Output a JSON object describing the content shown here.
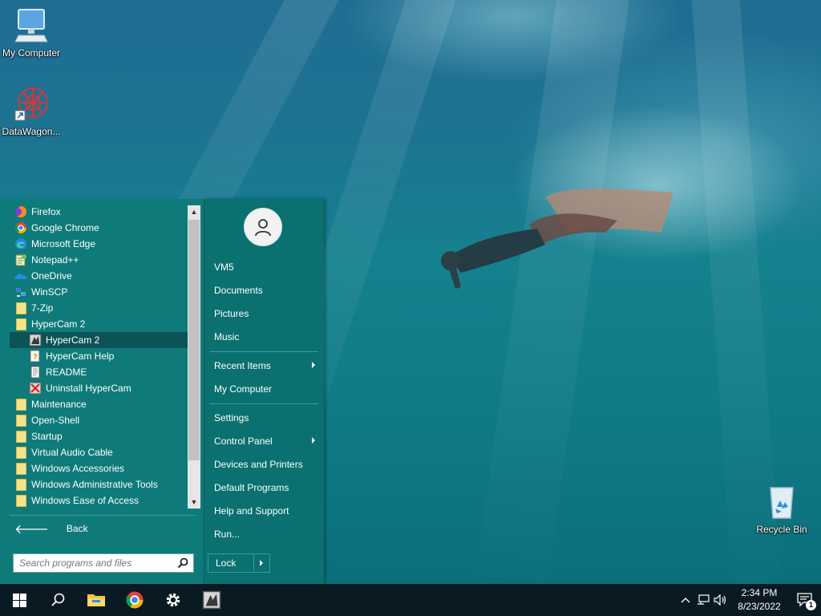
{
  "desktop": {
    "icons": [
      {
        "label": "My Computer",
        "icon": "computer-icon"
      },
      {
        "label": "DataWagon...",
        "icon": "datawagon-icon"
      },
      {
        "label": "Recycle Bin",
        "icon": "recycle-bin-icon"
      }
    ]
  },
  "start_menu": {
    "programs": [
      {
        "label": "Firefox",
        "icon": "firefox-icon"
      },
      {
        "label": "Google Chrome",
        "icon": "chrome-icon"
      },
      {
        "label": "Microsoft Edge",
        "icon": "edge-icon"
      },
      {
        "label": "Notepad++",
        "icon": "notepadpp-icon"
      },
      {
        "label": "OneDrive",
        "icon": "onedrive-icon"
      },
      {
        "label": "WinSCP",
        "icon": "winscp-icon"
      },
      {
        "label": "7-Zip",
        "icon": "folder-icon"
      },
      {
        "label": "HyperCam 2",
        "icon": "folder-icon"
      },
      {
        "label": "HyperCam 2",
        "icon": "hypercam-icon",
        "selected": true
      },
      {
        "label": "HyperCam Help",
        "icon": "help-file-icon"
      },
      {
        "label": "README",
        "icon": "document-icon"
      },
      {
        "label": "Uninstall HyperCam",
        "icon": "uninstall-icon"
      },
      {
        "label": "Maintenance",
        "icon": "folder-icon"
      },
      {
        "label": "Open-Shell",
        "icon": "folder-icon"
      },
      {
        "label": "Startup",
        "icon": "folder-icon"
      },
      {
        "label": "Virtual Audio Cable",
        "icon": "folder-icon"
      },
      {
        "label": "Windows Accessories",
        "icon": "folder-icon"
      },
      {
        "label": "Windows Administrative Tools",
        "icon": "folder-icon"
      },
      {
        "label": "Windows Ease of Access",
        "icon": "folder-icon"
      }
    ],
    "back_label": "Back",
    "search_placeholder": "Search programs and files",
    "user_name": "VM5",
    "right_items": {
      "documents": "Documents",
      "pictures": "Pictures",
      "music": "Music",
      "recent_items": "Recent Items",
      "my_computer": "My Computer",
      "settings": "Settings",
      "control_panel": "Control Panel",
      "devices_printers": "Devices and Printers",
      "default_programs": "Default Programs",
      "help_support": "Help and Support",
      "run": "Run..."
    },
    "lock_label": "Lock"
  },
  "taskbar": {
    "time": "2:34 PM",
    "date": "8/23/2022",
    "notification_count": "1"
  },
  "colors": {
    "menu_left": "#0f7a7a",
    "menu_right": "#0a7070",
    "selection": "#0c5358",
    "taskbar": "#0a1a22"
  }
}
